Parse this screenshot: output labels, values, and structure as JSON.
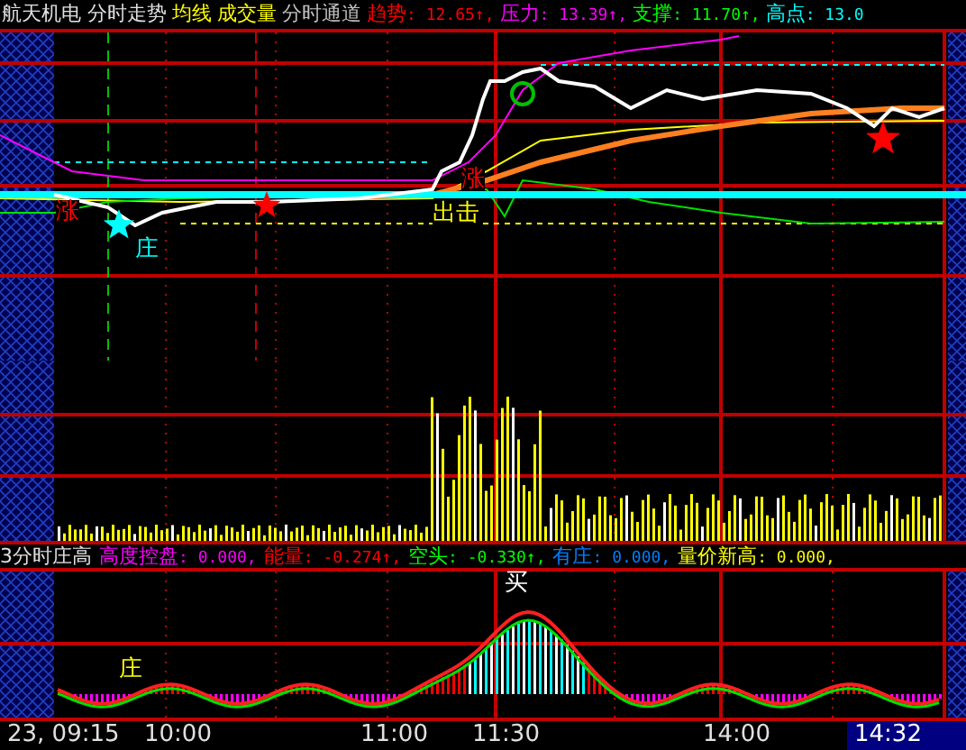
{
  "header": {
    "title": "航天机电 分时走势",
    "menu": [
      {
        "label": "均线",
        "color": "#ffff00"
      },
      {
        "label": "成交量",
        "color": "#ffff00"
      },
      {
        "label": "分时通道",
        "color": "#c0c0c0"
      }
    ],
    "readings": [
      {
        "label": "趋势",
        "value": ": 12.65↑,",
        "color": "#ff0000"
      },
      {
        "label": "压力",
        "value": ": 13.39↑,",
        "color": "#ff00ff"
      },
      {
        "label": "支撑",
        "value": ": 11.70↑,",
        "color": "#00ff00"
      },
      {
        "label": "高点",
        "value": ": 13.0",
        "color": "#00ffff"
      }
    ]
  },
  "price_chart": {
    "markers": [
      {
        "text": "涨",
        "color": "#ff0000"
      },
      {
        "text": "庄",
        "color": "#00ffff"
      },
      {
        "text": "出击",
        "color": "#ffff00"
      },
      {
        "text": "涨",
        "color": "#ff0000"
      }
    ]
  },
  "indicator": {
    "title": "3分时庄高",
    "readings": [
      {
        "label": "高度控盘",
        "value": ": 0.000,",
        "color": "#ff00ff"
      },
      {
        "label": "能量",
        "value": ": -0.274↑,",
        "color": "#ff0000"
      },
      {
        "label": "空头",
        "value": ": -0.330↑,",
        "color": "#00ff00"
      },
      {
        "label": "有庄",
        "value": ": 0.000,",
        "color": "#0080ff"
      },
      {
        "label": "量价新高",
        "value": ": 0.000,",
        "color": "#ffff00"
      }
    ],
    "markers": [
      {
        "text": "庄",
        "color": "#ffff00"
      },
      {
        "text": "买",
        "color": "#ffffff"
      }
    ]
  },
  "time_axis": [
    {
      "label": "23, 09:15",
      "selected": false
    },
    {
      "label": "10:00",
      "selected": false
    },
    {
      "label": "11:00",
      "selected": false
    },
    {
      "label": "11:30",
      "selected": false
    },
    {
      "label": "14:00",
      "selected": false
    },
    {
      "label": "14:32",
      "selected": true
    }
  ]
}
